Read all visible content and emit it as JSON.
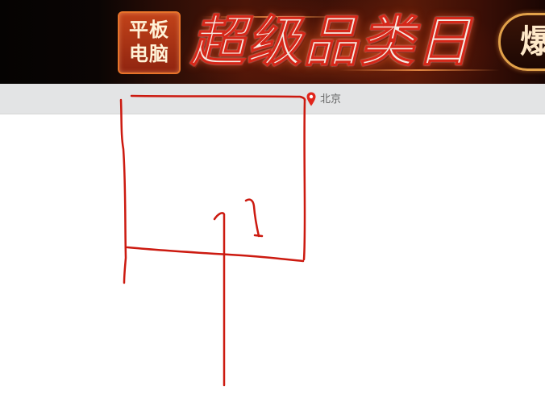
{
  "banner": {
    "badge_line1": "平板",
    "badge_line2": "电脑",
    "headline": "超级品类日",
    "cta_text": "爆",
    "colors": {
      "badge_bg": "#b5361a",
      "badge_border": "#e8732a",
      "headline": "#f4ece4",
      "background_dark": "#0a0504"
    }
  },
  "location_bar": {
    "icon": "map-pin-icon",
    "city": "北京",
    "pin_color": "#e1251b",
    "background": "#e3e4e5"
  },
  "annotation": {
    "description_color": "#cc1a10"
  }
}
